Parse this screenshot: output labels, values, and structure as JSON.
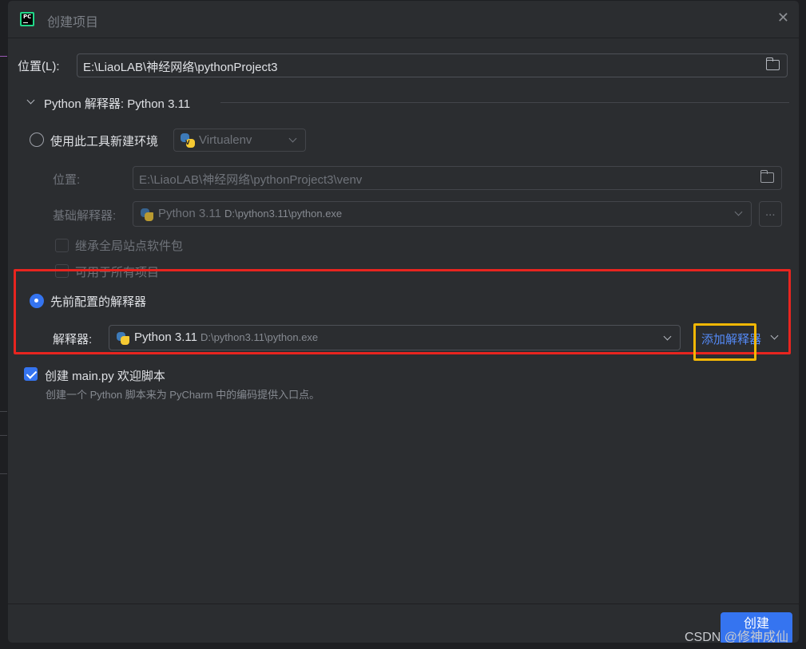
{
  "window": {
    "title": "创建项目"
  },
  "location": {
    "label": "位置(L):",
    "value": "E:\\LiaoLAB\\神经网络\\pythonProject3"
  },
  "section": {
    "title": "Python 解释器: Python 3.11"
  },
  "new_env": {
    "radio_label": "使用此工具新建环境",
    "tool": "Virtualenv",
    "location_label": "位置:",
    "location_value": "E:\\LiaoLAB\\神经网络\\pythonProject3\\venv",
    "base_label": "基础解释器:",
    "base_name": "Python 3.11",
    "base_path": "D:\\python3.11\\python.exe",
    "more_button": "...",
    "inherit_label": "继承全局站点软件包",
    "all_projects_label": "可用于所有项目"
  },
  "previous": {
    "radio_label": "先前配置的解释器",
    "interp_label": "解释器:",
    "interp_name": "Python 3.11",
    "interp_path": "D:\\python3.11\\python.exe",
    "add_link": "添加解释器"
  },
  "main_script": {
    "label": "创建 main.py 欢迎脚本",
    "description": "创建一个 Python 脚本来为 PyCharm 中的编码提供入口点。",
    "checked": true
  },
  "footer": {
    "create_button": "创建"
  },
  "watermark": "CSDN @修神成仙",
  "colors": {
    "accent": "#3574f0",
    "red_highlight": "#e8251f",
    "yellow_highlight": "#f2b705",
    "link": "#548af7"
  }
}
